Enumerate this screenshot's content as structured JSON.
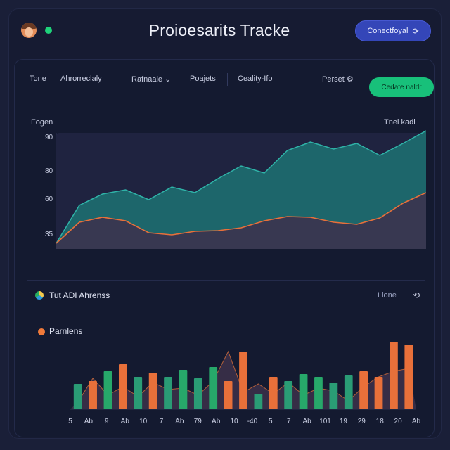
{
  "header": {
    "title": "Proioesarits Tracke",
    "connect_label": "Conectfoyal",
    "connect_icon": "refresh-icon",
    "status_color": "#1ed27a"
  },
  "toolbar": {
    "items": [
      "Tone",
      "Ahrorreclaly",
      "Rafnaale",
      "Poajets",
      "Ceality-Ifo"
    ],
    "period_label": "Perset",
    "update_label": "Cedate naldr"
  },
  "chart_data": [
    {
      "type": "area",
      "title": "",
      "label_left": "Fogen",
      "label_right": "Tnel kadl",
      "y_ticks": [
        "90",
        "80",
        "60",
        "35"
      ],
      "series": [
        {
          "values": [
            8,
            62,
            78,
            84,
            70,
            88,
            80,
            100,
            118,
            108,
            140,
            152,
            142,
            150,
            133,
            150,
            168
          ],
          "color": "#1f6f72"
        },
        {
          "values": [
            8,
            38,
            45,
            40,
            23,
            20,
            25,
            26,
            30,
            40,
            46,
            45,
            38,
            35,
            44,
            65,
            80
          ],
          "color": "#e8703a"
        }
      ],
      "colors": {
        "teal": "#1f6f72",
        "orange": "#e8703a",
        "background": "#2c2d48"
      }
    },
    {
      "type": "bar",
      "title": "Parnlens",
      "section_title": "Tut ADI Ahrenss",
      "section_right": "Lione",
      "x_labels": [
        "5",
        "Ab",
        "9",
        "Ab",
        "10",
        "7",
        "Ab",
        "79",
        "Ab",
        "10",
        "-40",
        "5",
        "7",
        "Ab",
        "101",
        "19",
        "29",
        "18",
        "20",
        "Ab"
      ],
      "bars": [
        {
          "value": 36,
          "color": "#2a9c75"
        },
        {
          "value": 40,
          "color": "#e8703a"
        },
        {
          "value": 54,
          "color": "#27a86a"
        },
        {
          "value": 64,
          "color": "#e8703a"
        },
        {
          "value": 46,
          "color": "#2a9c75"
        },
        {
          "value": 52,
          "color": "#e8703a"
        },
        {
          "value": 46,
          "color": "#2a9c75"
        },
        {
          "value": 56,
          "color": "#27a86a"
        },
        {
          "value": 44,
          "color": "#2a9c75"
        },
        {
          "value": 60,
          "color": "#27a86a"
        },
        {
          "value": 40,
          "color": "#e8703a"
        },
        {
          "value": 82,
          "color": "#e8703a"
        },
        {
          "value": 22,
          "color": "#2a9c75"
        },
        {
          "value": 46,
          "color": "#e8703a"
        },
        {
          "value": 40,
          "color": "#2a9c75"
        },
        {
          "value": 50,
          "color": "#27a86a"
        },
        {
          "value": 46,
          "color": "#27a86a"
        },
        {
          "value": 38,
          "color": "#2a9c75"
        },
        {
          "value": 48,
          "color": "#2a9c75"
        },
        {
          "value": 54,
          "color": "#e8703a"
        },
        {
          "value": 46,
          "color": "#e8703a"
        },
        {
          "value": 96,
          "color": "#e8703a"
        },
        {
          "value": 92,
          "color": "#e8703a"
        }
      ],
      "background_series": [
        10,
        44,
        20,
        32,
        18,
        38,
        28,
        30,
        20,
        40,
        82,
        24,
        36,
        22,
        38,
        20,
        30,
        26,
        12,
        32,
        46,
        54,
        58
      ]
    }
  ]
}
